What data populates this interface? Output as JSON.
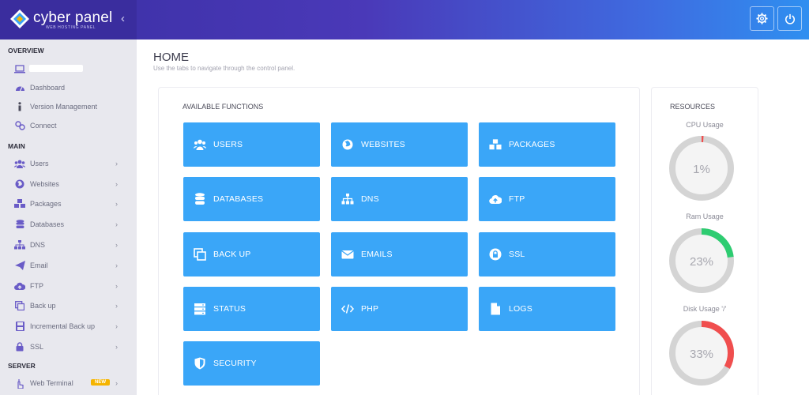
{
  "brand": {
    "name": "cyber panel",
    "subtitle": "WEB HOSTING PANEL"
  },
  "colors": {
    "accent": "#3aa6f8",
    "gauge_track": "#d4d4d4",
    "gauge_red": "#f04e4e",
    "gauge_green": "#2ecc71",
    "badge": "#f5b400"
  },
  "sidebar": {
    "overview_label": "OVERVIEW",
    "overview_items": [
      {
        "label": "Dashboard",
        "icon": "dashboard-icon"
      },
      {
        "label": "Version Management",
        "icon": "info-icon"
      },
      {
        "label": "Connect",
        "icon": "link-icon"
      }
    ],
    "main_label": "MAIN",
    "main_items": [
      {
        "label": "Users",
        "icon": "users-icon"
      },
      {
        "label": "Websites",
        "icon": "globe-icon"
      },
      {
        "label": "Packages",
        "icon": "cubes-icon"
      },
      {
        "label": "Databases",
        "icon": "database-icon"
      },
      {
        "label": "DNS",
        "icon": "sitemap-icon"
      },
      {
        "label": "Email",
        "icon": "paper-plane-icon"
      },
      {
        "label": "FTP",
        "icon": "cloud-upload-icon"
      },
      {
        "label": "Back up",
        "icon": "copy-icon"
      },
      {
        "label": "Incremental Back up",
        "icon": "save-icon"
      },
      {
        "label": "SSL",
        "icon": "lock-icon"
      }
    ],
    "server_label": "SERVER",
    "server_items": [
      {
        "label": "Web Terminal",
        "icon": "terminal-icon",
        "badge": "NEW"
      }
    ]
  },
  "main": {
    "title": "HOME",
    "subtitle": "Use the tabs to navigate through the control panel.",
    "functions_heading": "AVAILABLE FUNCTIONS",
    "tiles": [
      {
        "label": "USERS",
        "icon": "users-icon"
      },
      {
        "label": "WEBSITES",
        "icon": "globe-icon"
      },
      {
        "label": "PACKAGES",
        "icon": "cubes-icon"
      },
      {
        "label": "DATABASES",
        "icon": "database-icon"
      },
      {
        "label": "DNS",
        "icon": "sitemap-icon"
      },
      {
        "label": "FTP",
        "icon": "cloud-upload-icon"
      },
      {
        "label": "BACK UP",
        "icon": "copy-icon"
      },
      {
        "label": "EMAILS",
        "icon": "envelope-icon"
      },
      {
        "label": "SSL",
        "icon": "lock-icon"
      },
      {
        "label": "STATUS",
        "icon": "server-icon"
      },
      {
        "label": "PHP",
        "icon": "code-icon"
      },
      {
        "label": "LOGS",
        "icon": "file-icon"
      },
      {
        "label": "SECURITY",
        "icon": "shield-icon"
      }
    ]
  },
  "resources": {
    "heading": "RESOURCES",
    "gauges": [
      {
        "label": "CPU Usage",
        "percent": 1,
        "text": "1%",
        "color": "#f04e4e"
      },
      {
        "label": "Ram Usage",
        "percent": 23,
        "text": "23%",
        "color": "#2ecc71"
      },
      {
        "label": "Disk Usage '/'",
        "percent": 33,
        "text": "33%",
        "color": "#f04e4e"
      }
    ]
  }
}
